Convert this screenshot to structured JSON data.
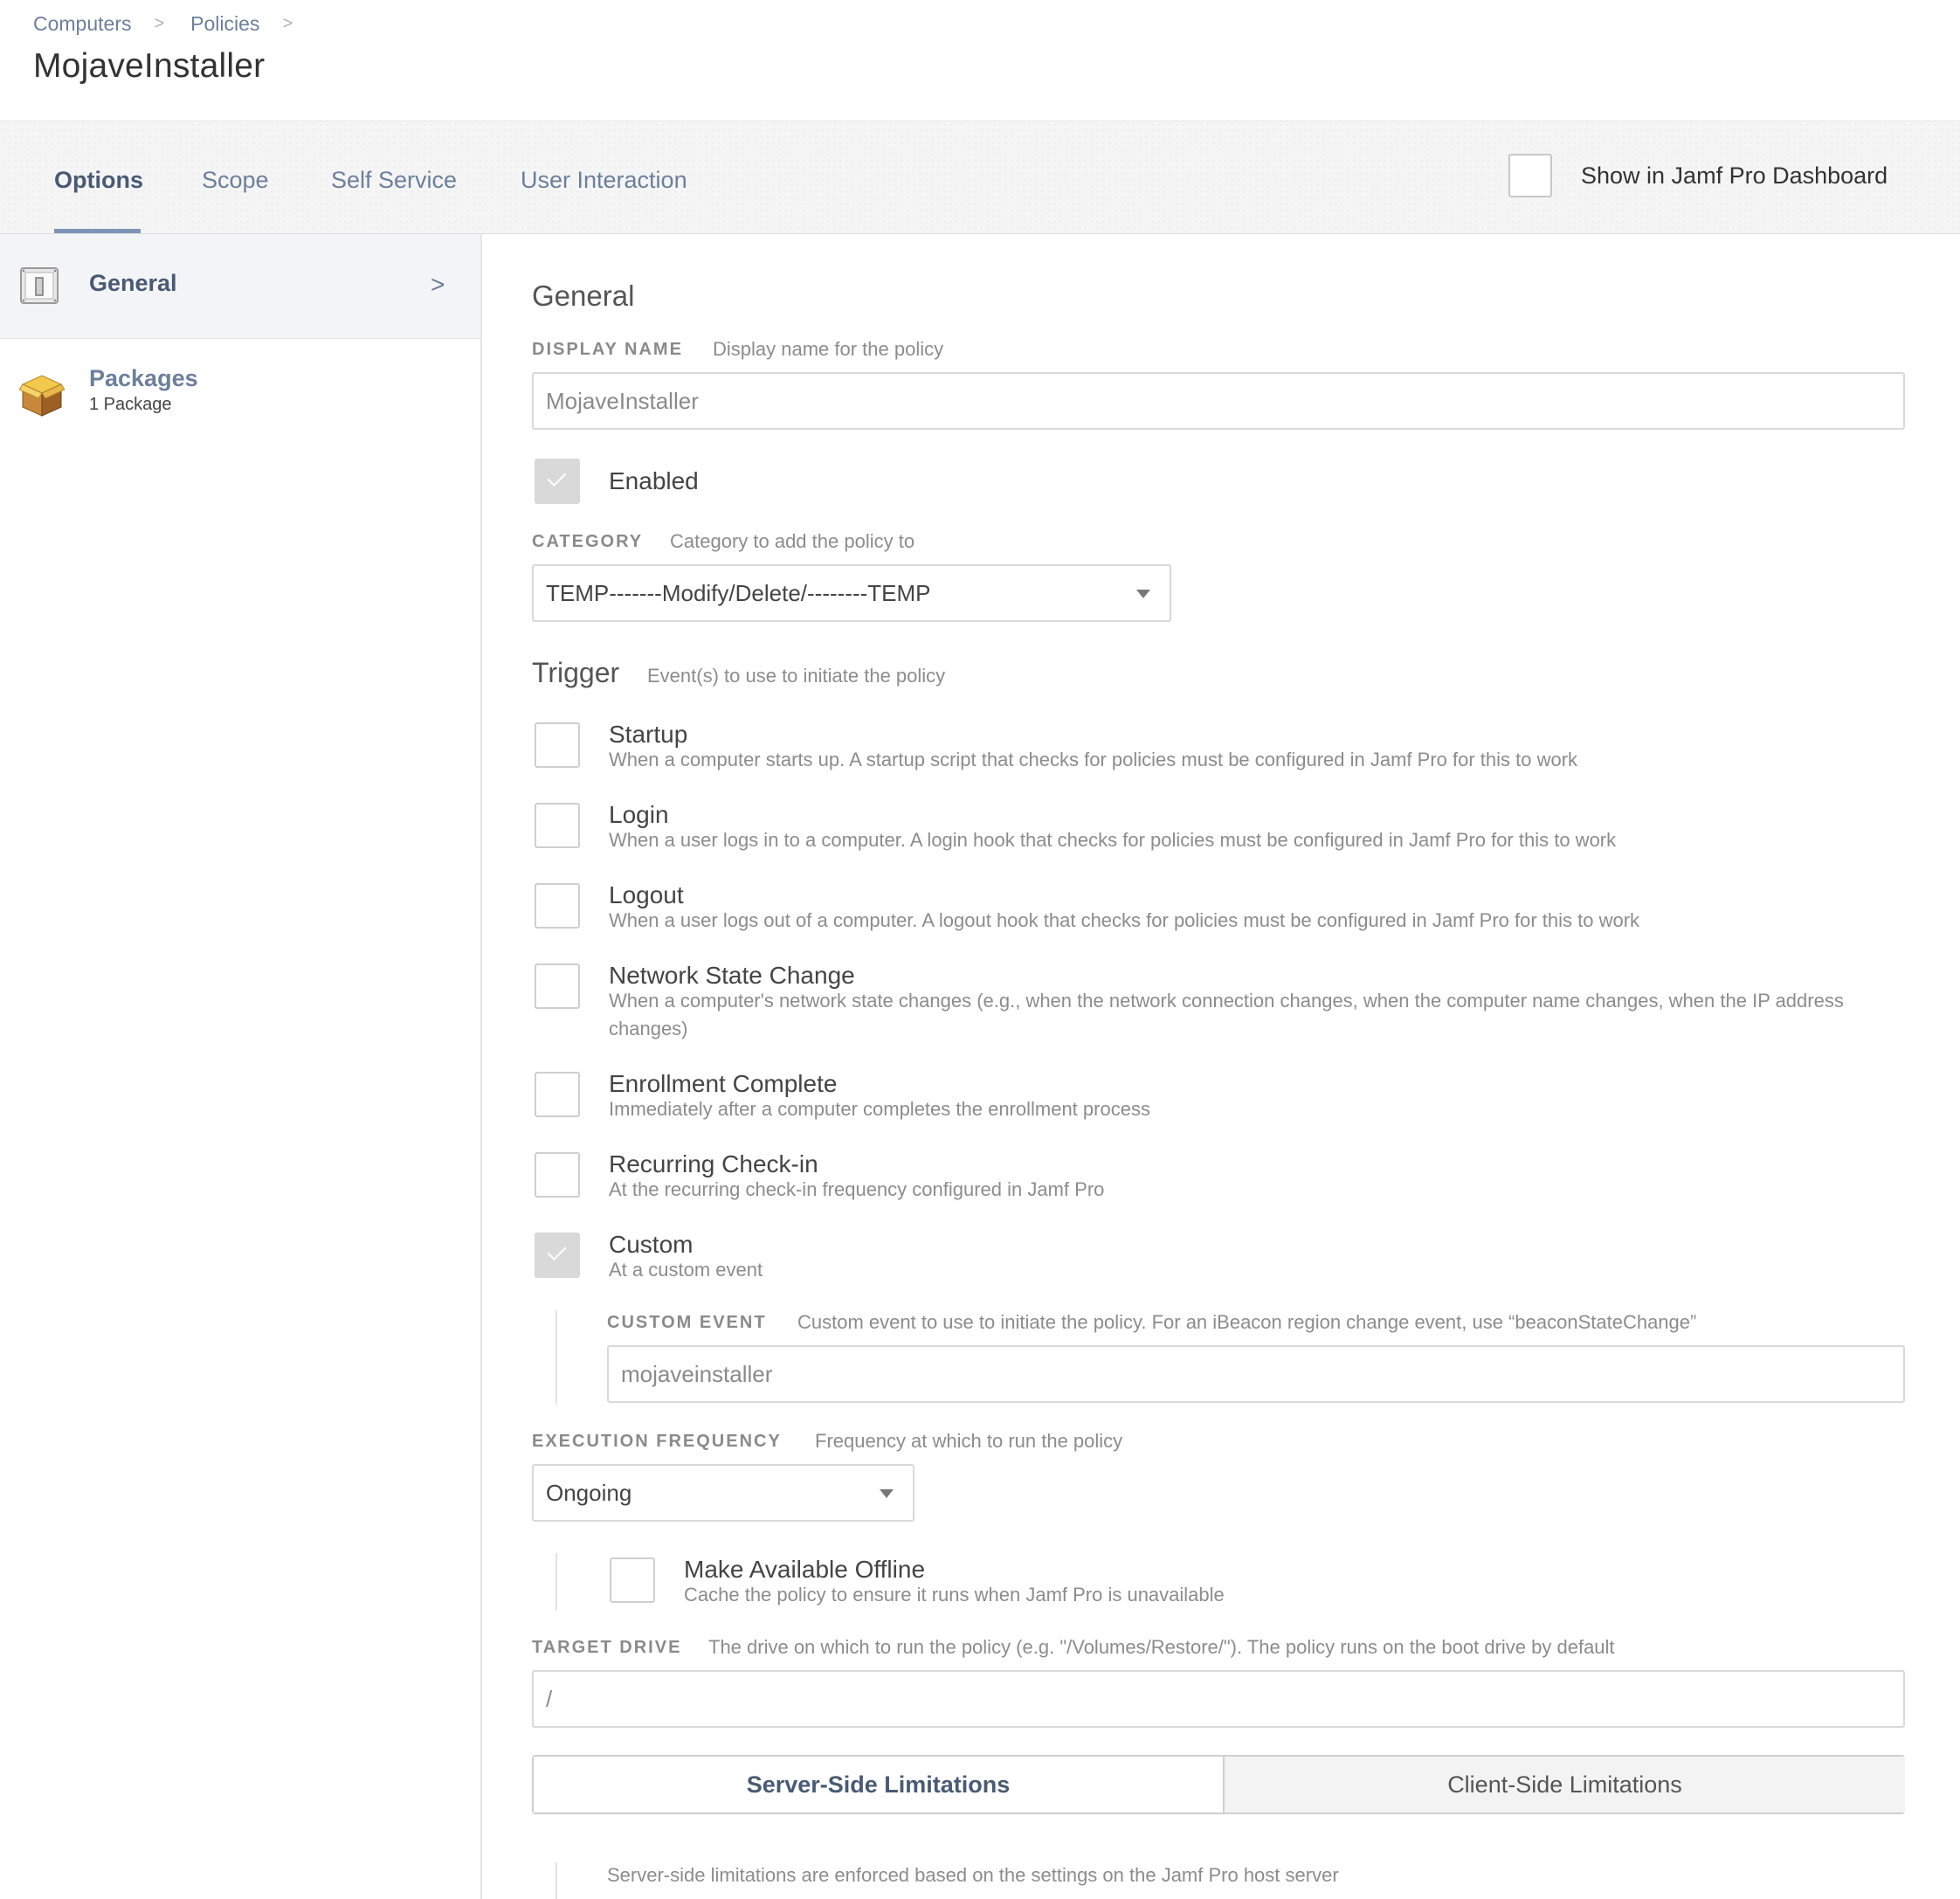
{
  "breadcrumb": {
    "items": [
      "Computers",
      "Policies"
    ],
    "separator": ">"
  },
  "page_title": "MojaveInstaller",
  "tabs": [
    {
      "label": "Options",
      "active": true
    },
    {
      "label": "Scope",
      "active": false
    },
    {
      "label": "Self Service",
      "active": false
    },
    {
      "label": "User Interaction",
      "active": false
    }
  ],
  "dashboard": {
    "label": "Show in Jamf Pro Dashboard",
    "checked": false
  },
  "sidebar": {
    "general": {
      "label": "General",
      "chevron": ">"
    },
    "packages": {
      "label": "Packages",
      "sublabel": "1 Package"
    }
  },
  "general": {
    "section_title": "General",
    "display_name": {
      "label": "DISPLAY NAME",
      "description": "Display name for the policy",
      "value": "MojaveInstaller"
    },
    "enabled": {
      "label": "Enabled",
      "checked": true
    },
    "category": {
      "label": "CATEGORY",
      "description": "Category to add the policy to",
      "value": "TEMP-------Modify/Delete/--------TEMP"
    },
    "trigger": {
      "title": "Trigger",
      "description": "Event(s) to use to initiate the policy",
      "items": [
        {
          "title": "Startup",
          "desc": "When a computer starts up. A startup script that checks for policies must be configured in Jamf Pro for this to work",
          "checked": false
        },
        {
          "title": "Login",
          "desc": "When a user logs in to a computer. A login hook that checks for policies must be configured in Jamf Pro for this to work",
          "checked": false
        },
        {
          "title": "Logout",
          "desc": "When a user logs out of a computer. A logout hook that checks for policies must be configured in Jamf Pro for this to work",
          "checked": false
        },
        {
          "title": "Network State Change",
          "desc": "When a computer's network state changes (e.g., when the network connection changes, when the computer name changes, when the IP address changes)",
          "checked": false
        },
        {
          "title": "Enrollment Complete",
          "desc": "Immediately after a computer completes the enrollment process",
          "checked": false
        },
        {
          "title": "Recurring Check-in",
          "desc": "At the recurring check-in frequency configured in Jamf Pro",
          "checked": false
        },
        {
          "title": "Custom",
          "desc": "At a custom event",
          "checked": true
        }
      ]
    },
    "custom_event": {
      "label": "CUSTOM EVENT",
      "description": "Custom event to use to initiate the policy. For an iBeacon region change event, use “beaconStateChange”",
      "value": "mojaveinstaller"
    },
    "execution_frequency": {
      "label": "EXECUTION FREQUENCY",
      "description": "Frequency at which to run the policy",
      "value": "Ongoing"
    },
    "offline": {
      "title": "Make Available Offline",
      "desc": "Cache the policy to ensure it runs when Jamf Pro is unavailable",
      "checked": false
    },
    "target_drive": {
      "label": "TARGET DRIVE",
      "description": "The drive on which to run the policy (e.g. \"/Volumes/Restore/\"). The policy runs on the boot drive by default",
      "value": "/"
    },
    "limitations": {
      "server_label": "Server-Side Limitations",
      "client_label": "Client-Side Limitations",
      "active": "server"
    },
    "server_note": "Server-side limitations are enforced based on the settings on the Jamf Pro host server"
  }
}
